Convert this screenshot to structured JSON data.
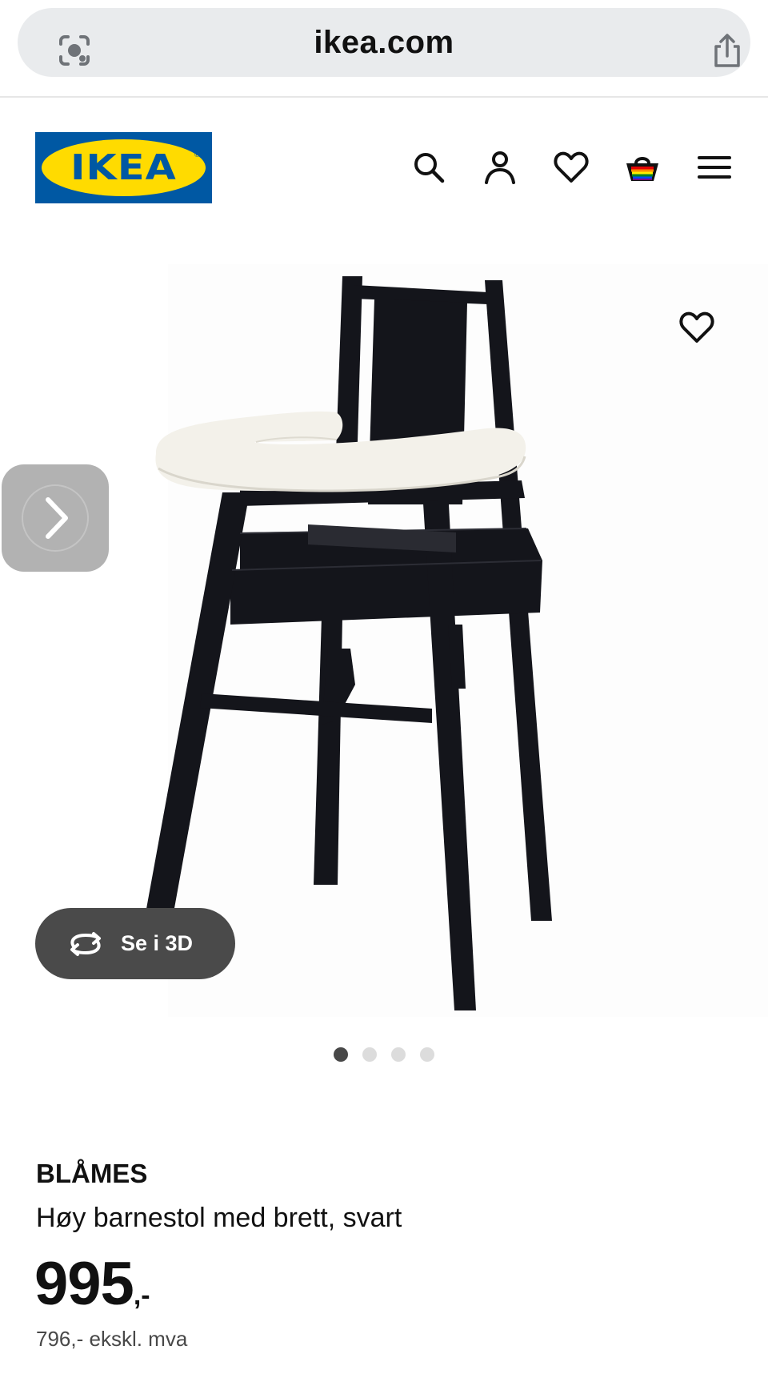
{
  "browser": {
    "url": "ikea.com"
  },
  "header": {
    "logo_text": "IKEA",
    "logo_reg": "®",
    "brand_colors": {
      "blue": "#0058a3",
      "yellow": "#ffdb00"
    },
    "icons": [
      "search-icon",
      "account-icon",
      "favourites-icon",
      "cart-icon",
      "menu-icon"
    ]
  },
  "gallery": {
    "view_3d_label": "Se i 3D",
    "page_count": 4,
    "active_page": 1
  },
  "product": {
    "name": "BLÅMES",
    "description": "Høy barnestol med brett, svart",
    "price_integer": "995",
    "price_suffix": ",-",
    "price_ex_vat": "796,- ekskl. mva"
  }
}
